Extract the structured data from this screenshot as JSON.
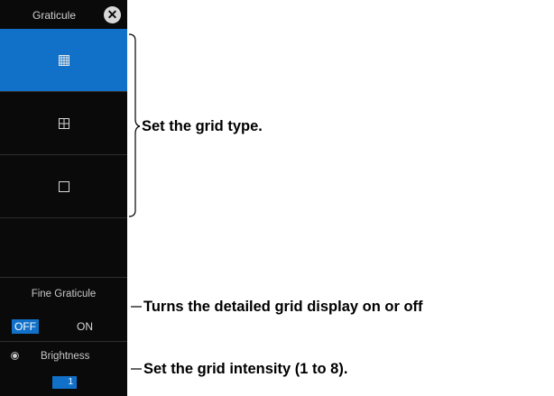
{
  "panel": {
    "title": "Graticule",
    "grid_types": [
      {
        "icon": "grid-full-icon",
        "selected": true
      },
      {
        "icon": "grid-cross-icon",
        "selected": false
      },
      {
        "icon": "grid-frame-icon",
        "selected": false
      }
    ],
    "fine_graticule": {
      "label": "Fine Graticule",
      "off_label": "OFF",
      "on_label": "ON",
      "value": "OFF"
    },
    "brightness": {
      "label": "Brightness",
      "value": "1"
    }
  },
  "annotations": {
    "grid_type": "Set the grid type.",
    "fine_graticule": "Turns the detailed grid display on or off",
    "brightness": "Set the grid intensity (1 to 8)."
  },
  "colors": {
    "selected": "#1170c8",
    "panel_bg": "#0a0a0a",
    "text": "#d8d8d8"
  }
}
